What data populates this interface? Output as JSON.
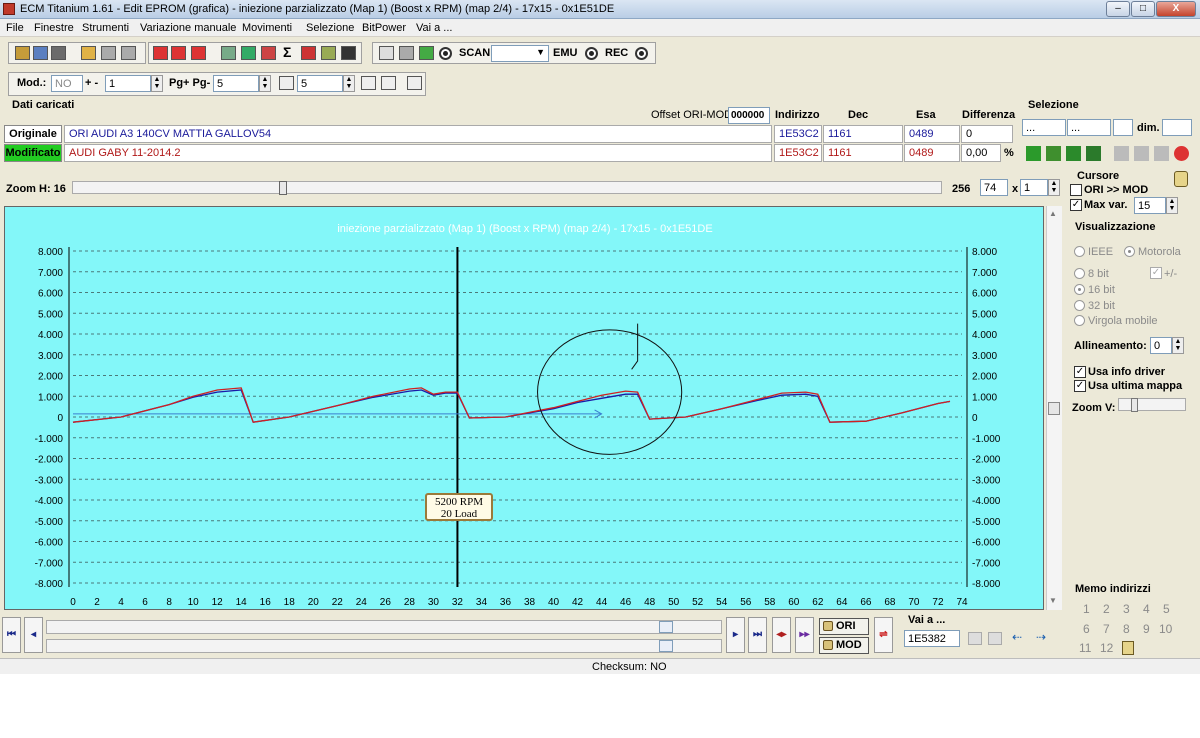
{
  "window": {
    "title": "ECM Titanium 1.61 - Edit EPROM (grafica) - iniezione parzializzato (Map 1) (Boost x RPM) (map 2/4) - 17x15 - 0x1E51DE",
    "minimize_label": "–",
    "maximize_label": "□",
    "close_label": "X"
  },
  "menu": [
    "File",
    "Finestre",
    "Strumenti",
    "Variazione manuale",
    "Movimenti",
    "Selezione",
    "BitPower",
    "Vai a ..."
  ],
  "toolbar": {
    "scan_label": "SCAN",
    "emu_label": "EMU",
    "rec_label": "REC",
    "sigma": "Σ"
  },
  "toolbar2": {
    "mod_label": "Mod.:",
    "mod_value": "NO",
    "step_label": "+ -",
    "step_value": "1",
    "page_label": "Pg+ Pg-",
    "page_value": "5",
    "p_value": "5"
  },
  "dati": {
    "header": "Dati caricati",
    "offset_label": "Offset ORI-MOD",
    "offset_value": "000000",
    "col_indirizzo": "Indirizzo",
    "col_dec": "Dec",
    "col_esa": "Esa",
    "col_diff": "Differenza",
    "originale_label": "Originale",
    "originale_name": "ORI AUDI A3 140CV MATTIA GALLOV54",
    "originale_addr": "1E53C2",
    "originale_dec": "1161",
    "originale_esa": "0489",
    "originale_diff": "0",
    "modificato_label": "Modificato",
    "modificato_name": "AUDI GABY 11-2014.2",
    "modificato_addr": "1E53C2",
    "modificato_dec": "1161",
    "modificato_esa": "0489",
    "modificato_diff": "0,00",
    "pct": "%"
  },
  "selezione": {
    "header": "Selezione",
    "f1": "...",
    "f2": "...",
    "dim_label": "dim."
  },
  "zoom": {
    "label": "Zoom H: 16",
    "right_value": "256",
    "field_value": "74",
    "x_label": "x",
    "x_value": "1"
  },
  "cursore": {
    "header": "Cursore",
    "ori_mod": "ORI >> MOD",
    "max_var_label": "Max var.",
    "max_var_value": "15"
  },
  "visualizzazione": {
    "header": "Visualizzazione",
    "ieee": "IEEE",
    "motorola": "Motorola",
    "bit8": "8 bit",
    "plusminus": "+/-",
    "bit16": "16 bit",
    "bit32": "32 bit",
    "virgola": "Virgola mobile",
    "allineamento_label": "Allineamento:",
    "allineamento_value": "0",
    "usa_info": "Usa info driver",
    "usa_ultima": "Usa ultima mappa",
    "zoom_v": "Zoom V:"
  },
  "memo": {
    "header": "Memo indirizzi",
    "numbers": [
      "1",
      "2",
      "3",
      "4",
      "5",
      "6",
      "7",
      "8",
      "9",
      "10",
      "11",
      "12"
    ]
  },
  "bottom": {
    "ori_btn": "ORI",
    "mod_btn": "MOD",
    "vai_label": "Vai a ...",
    "vai_value": "1E5382"
  },
  "status": {
    "checksum": "Checksum: NO"
  },
  "tooltip": {
    "line1": "5200 RPM",
    "line2": "20 Load"
  },
  "colors": {
    "plot_bg": "#83f7f9",
    "ori_line": "#1a1aa8",
    "mod_line": "#d02020",
    "cursor_line": "#3a7fd0",
    "originale_bg": "#ffffff",
    "modificato_bg": "#22cc22"
  },
  "chart_data": {
    "type": "line",
    "title": "iniezione parzializzato (Map 1) (Boost x RPM) (map 2/4) - 17x15 - 0x1E51DE",
    "ylim": [
      -8000,
      8000
    ],
    "xlim": [
      0,
      74
    ],
    "y_ticks": [
      "8.000",
      "7.000",
      "6.000",
      "5.000",
      "4.000",
      "3.000",
      "2.000",
      "1.000",
      "0",
      "-1.000",
      "-2.000",
      "-3.000",
      "-4.000",
      "-5.000",
      "-6.000",
      "-7.000",
      "-8.000"
    ],
    "x_ticks": [
      "0",
      "2",
      "4",
      "6",
      "8",
      "10",
      "12",
      "14",
      "16",
      "18",
      "20",
      "22",
      "24",
      "26",
      "28",
      "30",
      "32",
      "34",
      "36",
      "38",
      "40",
      "42",
      "44",
      "46",
      "48",
      "50",
      "52",
      "54",
      "56",
      "58",
      "60",
      "62",
      "64",
      "66",
      "68",
      "70",
      "72",
      "74"
    ],
    "grid": true,
    "cursor_x": 32,
    "series": [
      {
        "name": "ORI",
        "points": [
          [
            0,
            -250
          ],
          [
            4,
            0
          ],
          [
            8,
            600
          ],
          [
            10,
            950
          ],
          [
            12,
            1200
          ],
          [
            14,
            1300
          ],
          [
            15,
            -250
          ],
          [
            18,
            0
          ],
          [
            22,
            550
          ],
          [
            25,
            950
          ],
          [
            28,
            1250
          ],
          [
            29,
            1300
          ],
          [
            30,
            1050
          ],
          [
            31,
            1150
          ],
          [
            32,
            1150
          ],
          [
            33,
            -50
          ],
          [
            36,
            0
          ],
          [
            40,
            400
          ],
          [
            42,
            700
          ],
          [
            44,
            900
          ],
          [
            46,
            1100
          ],
          [
            47,
            1100
          ],
          [
            48,
            -100
          ],
          [
            51,
            0
          ],
          [
            54,
            400
          ],
          [
            57,
            800
          ],
          [
            59,
            1050
          ],
          [
            61,
            1100
          ],
          [
            62,
            1000
          ],
          [
            63,
            -250
          ],
          [
            66,
            -200
          ],
          [
            69,
            200
          ],
          [
            72,
            650
          ],
          [
            73,
            750
          ]
        ]
      },
      {
        "name": "MOD",
        "points": [
          [
            0,
            -250
          ],
          [
            4,
            0
          ],
          [
            8,
            600
          ],
          [
            10,
            1000
          ],
          [
            12,
            1300
          ],
          [
            14,
            1400
          ],
          [
            15,
            -250
          ],
          [
            18,
            0
          ],
          [
            22,
            550
          ],
          [
            25,
            1000
          ],
          [
            28,
            1350
          ],
          [
            29,
            1400
          ],
          [
            30,
            1100
          ],
          [
            31,
            1200
          ],
          [
            32,
            1200
          ],
          [
            33,
            -50
          ],
          [
            36,
            0
          ],
          [
            40,
            450
          ],
          [
            42,
            750
          ],
          [
            44,
            1050
          ],
          [
            46,
            1250
          ],
          [
            47,
            1200
          ],
          [
            48,
            -100
          ],
          [
            51,
            0
          ],
          [
            54,
            400
          ],
          [
            57,
            850
          ],
          [
            59,
            1150
          ],
          [
            61,
            1200
          ],
          [
            62,
            1100
          ],
          [
            63,
            -250
          ],
          [
            66,
            -200
          ],
          [
            69,
            200
          ],
          [
            72,
            650
          ],
          [
            73,
            750
          ]
        ]
      }
    ],
    "cursor_series": [
      [
        0,
        150
      ],
      [
        44,
        150
      ]
    ],
    "annotation": {
      "circle_center": [
        46,
        1200
      ],
      "circle_rx": 6,
      "circle_ry": 3000,
      "stroke_top": [
        47,
        4500
      ]
    }
  }
}
